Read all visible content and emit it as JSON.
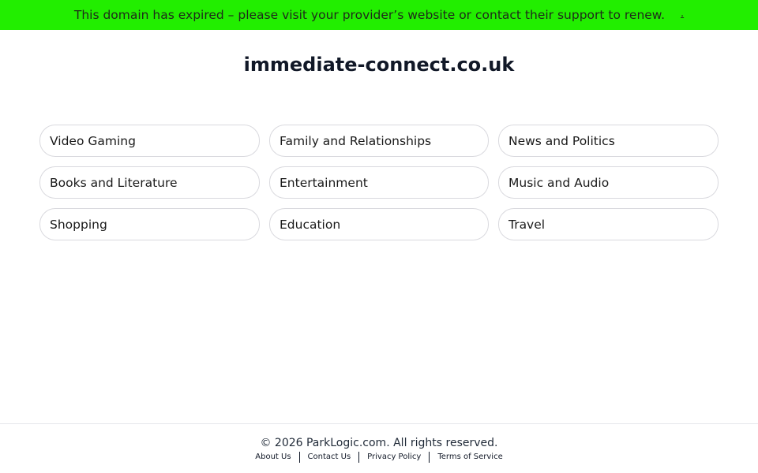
{
  "banner": {
    "message": "This domain has expired – please visit your provider’s website or contact their support to renew.",
    "link_text": ".",
    "background": "#22ee00"
  },
  "domain": "immediate-connect.co.uk",
  "categories": [
    "Video Gaming",
    "Family and Relationships",
    "News and Politics",
    "Books and Literature",
    "Entertainment",
    "Music and Audio",
    "Shopping",
    "Education",
    "Travel"
  ],
  "footer": {
    "copyright": "© 2026 ParkLogic.com. All rights reserved.",
    "links": [
      "About Us",
      "Contact Us",
      "Privacy Policy",
      "Terms of Service"
    ]
  }
}
